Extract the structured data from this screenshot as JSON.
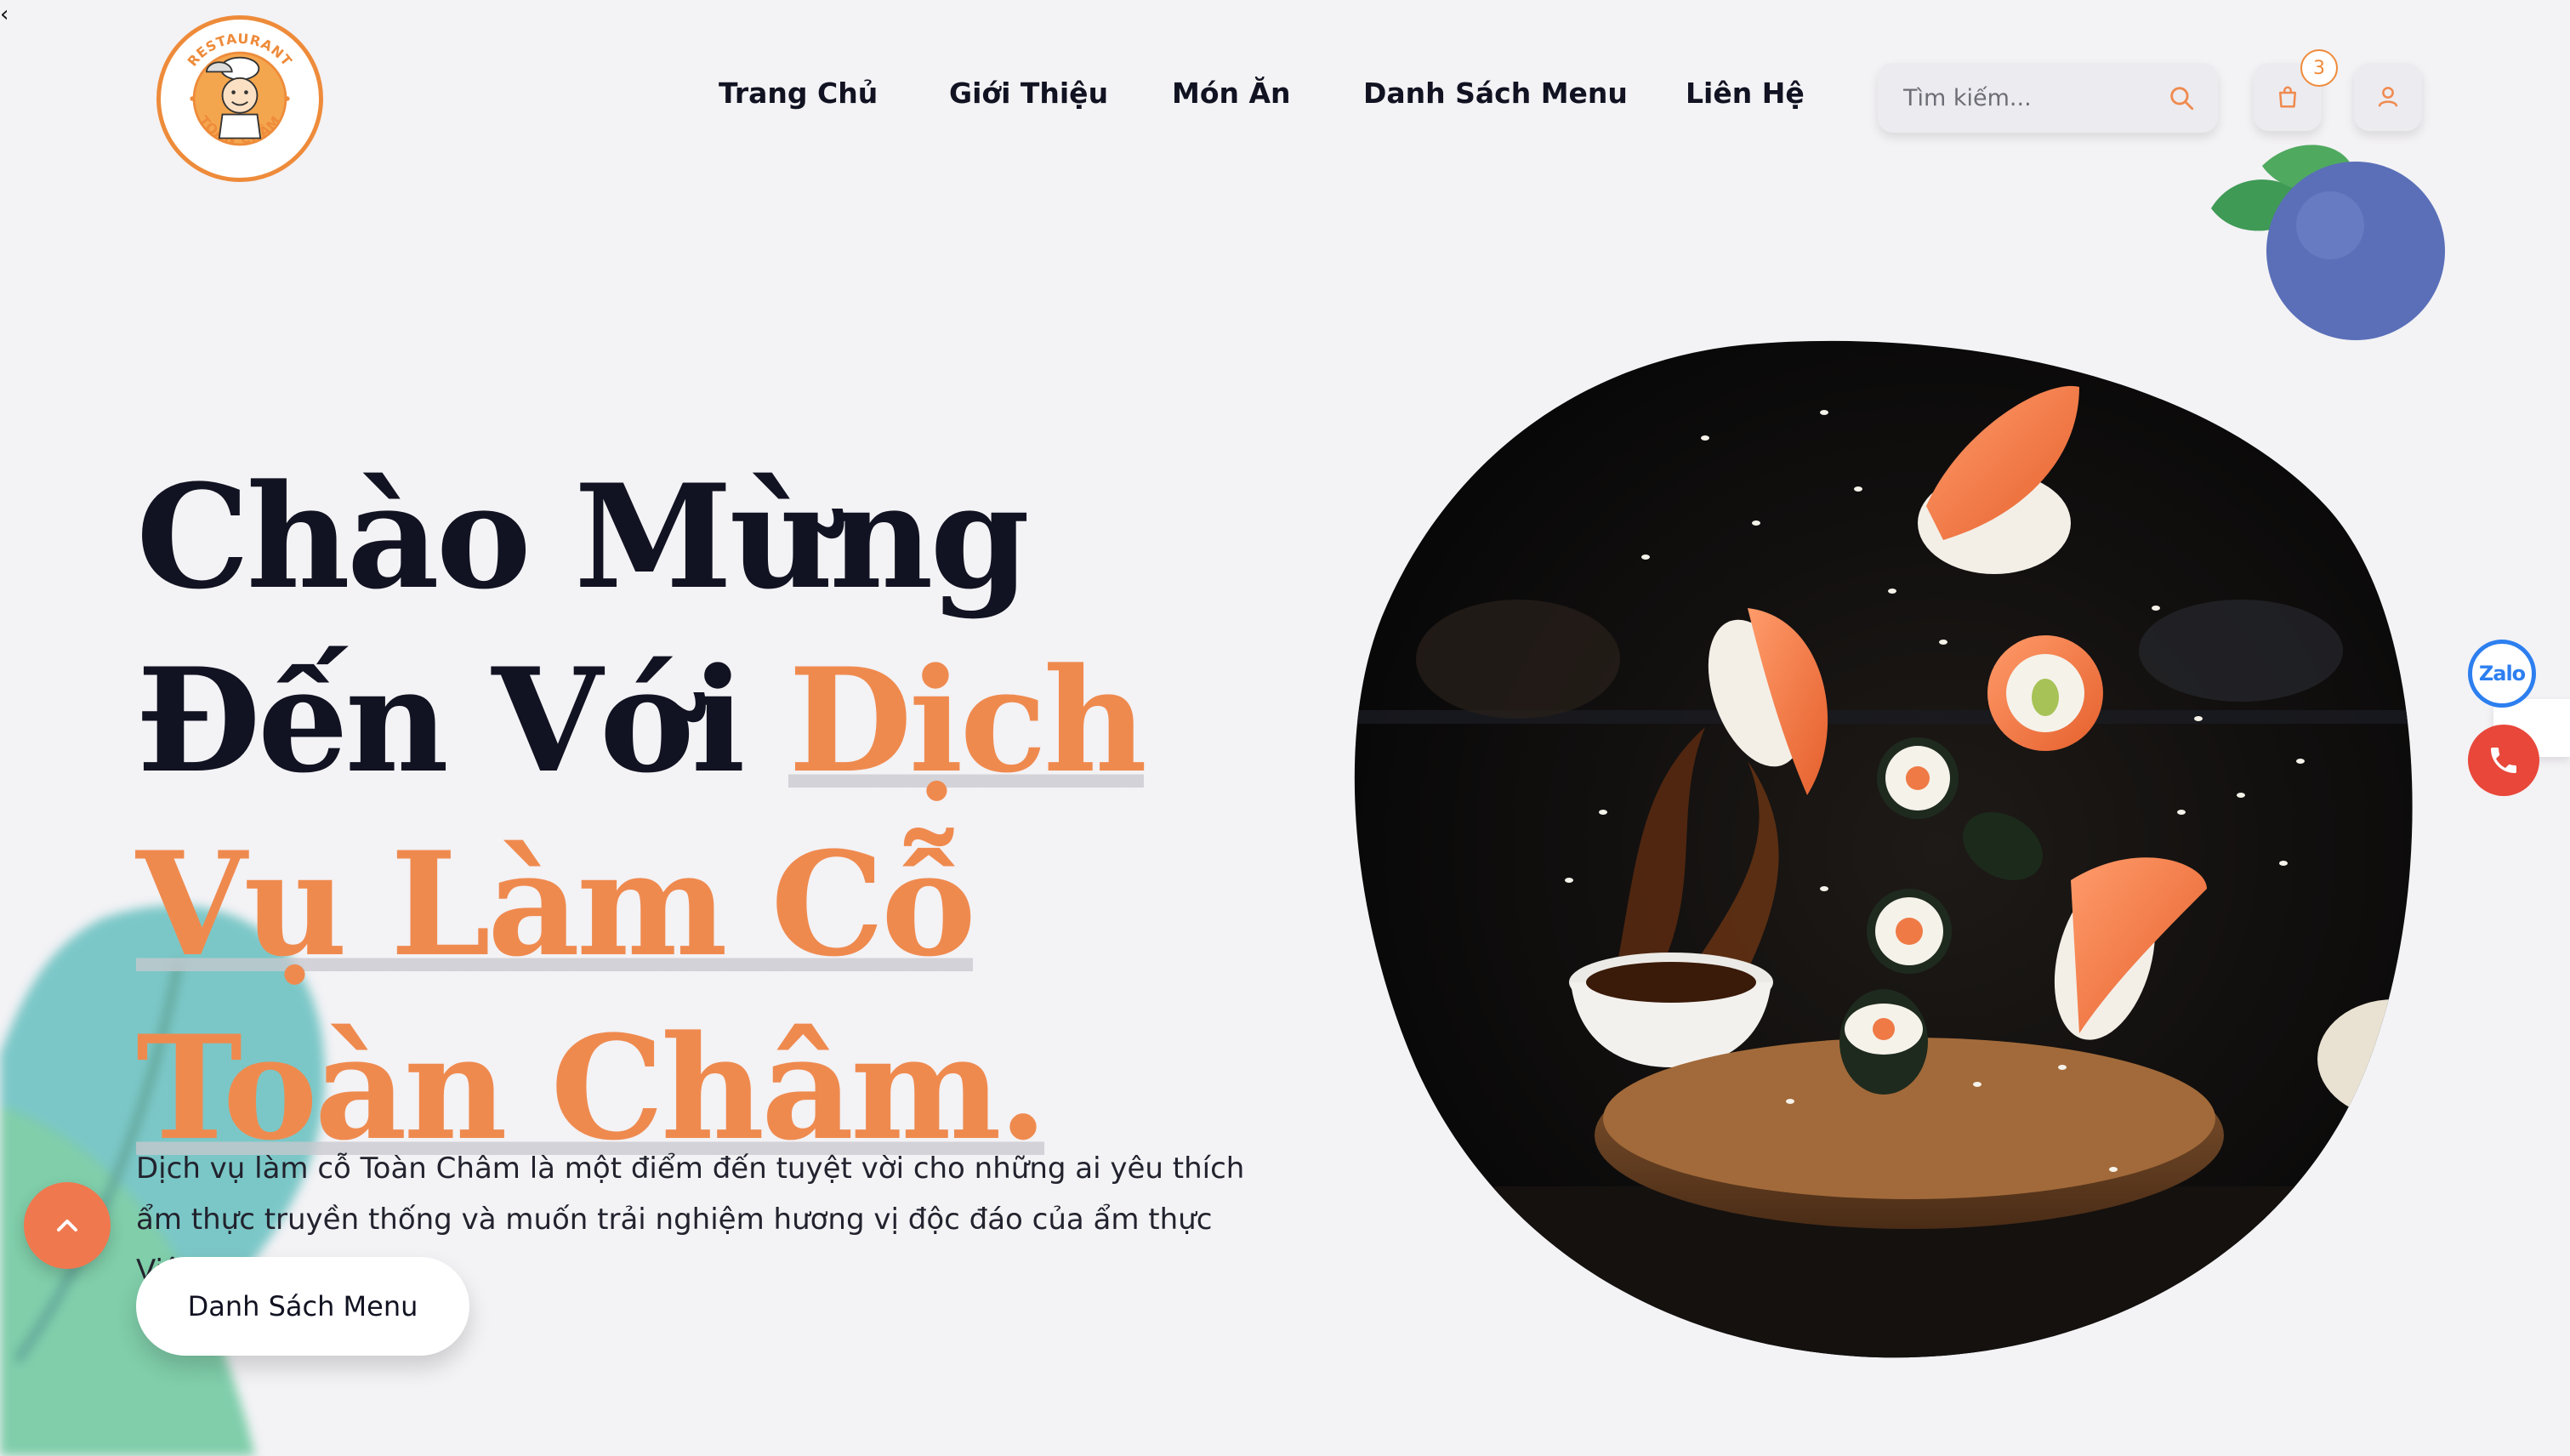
{
  "window": {
    "back_caret": "‹"
  },
  "logo": {
    "top_text": "RESTAURANT",
    "bottom_text": "TOÀN CHÂM",
    "icon": "chef-holding-cloche-logo"
  },
  "nav": {
    "items": [
      {
        "label": "Trang Chủ"
      },
      {
        "label": "Giới Thiệu"
      },
      {
        "label": "Món Ăn"
      },
      {
        "label": "Danh Sách Menu"
      },
      {
        "label": "Liên Hệ"
      }
    ]
  },
  "search": {
    "placeholder": "Tìm kiếm...",
    "value": "",
    "icon": "search-icon"
  },
  "cart": {
    "icon": "shopping-bag-icon",
    "count": "3"
  },
  "user": {
    "icon": "user-icon"
  },
  "hero": {
    "title_line1": "Chào Mừng",
    "title_line2_dark": "Đến Với ",
    "title_line2_orange": "Dịch",
    "title_line3": "Vụ Làm Cỗ",
    "title_line4": "Toàn Châm.",
    "description": "Dịch vụ làm cỗ Toàn Châm là một điểm đến tuyệt vời cho những ai yêu thích ẩm thực truyền thống và muốn trải nghiệm hương vị độc đáo của ẩm thực Việt Nam.",
    "button_label": "Danh Sách Menu",
    "image": "flying-sushi-with-soy-sauce-splash"
  },
  "contact": {
    "zalo_label": "Zalo",
    "phone_icon": "phone-icon"
  },
  "scroll_top": {
    "icon": "chevron-up-icon"
  },
  "colors": {
    "accent": "#ef8a4f",
    "dark_text": "#111322",
    "background": "#f3f2f5",
    "zalo_blue": "#2d7ff0",
    "phone_red": "#e8473a"
  }
}
